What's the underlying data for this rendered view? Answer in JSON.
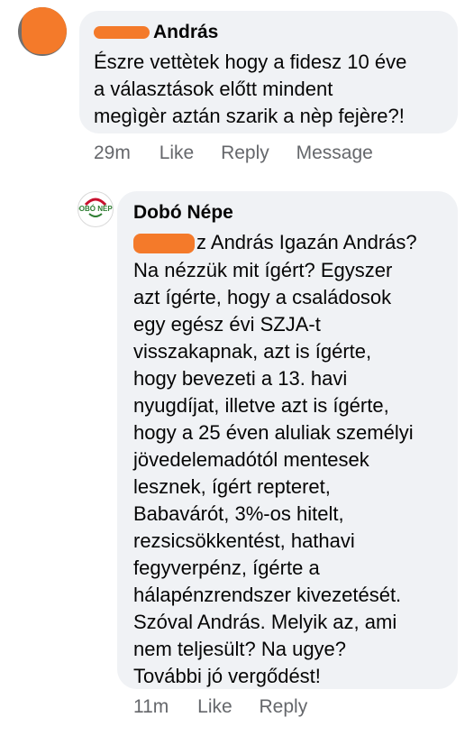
{
  "comments": [
    {
      "author": "András",
      "text": "Észre vettètek hogy a fidesz 10 éve\na választások előtt mindent\nmegìgèr aztán szarik a nèp fejère?!",
      "time": "29m",
      "actions": [
        "Like",
        "Reply",
        "Message"
      ]
    },
    {
      "author": "Dobó Népe",
      "mention_suffix": "z András",
      "text_first_line": "Igazán András?",
      "text": "Na nézzük mit ígért? Egyszer\nazt ígérte, hogy a családosok\negy egész évi SZJA-t\nvisszakapnak, azt is ígérte,\nhogy bevezeti a 13. havi\nnyugdíjat, illetve azt is ígérte,\nhogy a 25 éven aluliak személyi\njövedelemadótól mentesek\nlesznek, ígért repteret,\nBabavárót, 3%-os hitelt,\nrezsicsökkentést, hathavi\nfegyverpénz, ígérte a\nhálapénzrendszer kivezetését.\nSzóval András. Melyik az, ami\nnem teljesült? Na ugye?\nTovábbi jó vergődést!",
      "time": "11m",
      "actions": [
        "Like",
        "Reply"
      ],
      "avatar_text": "DOBÓ NÉPE"
    }
  ],
  "colors": {
    "bubble": "#f0f2f5",
    "secondary_text": "#65676b",
    "redaction": "#f47a2a",
    "logo_red": "#c8102e",
    "logo_green": "#2e7d32"
  }
}
